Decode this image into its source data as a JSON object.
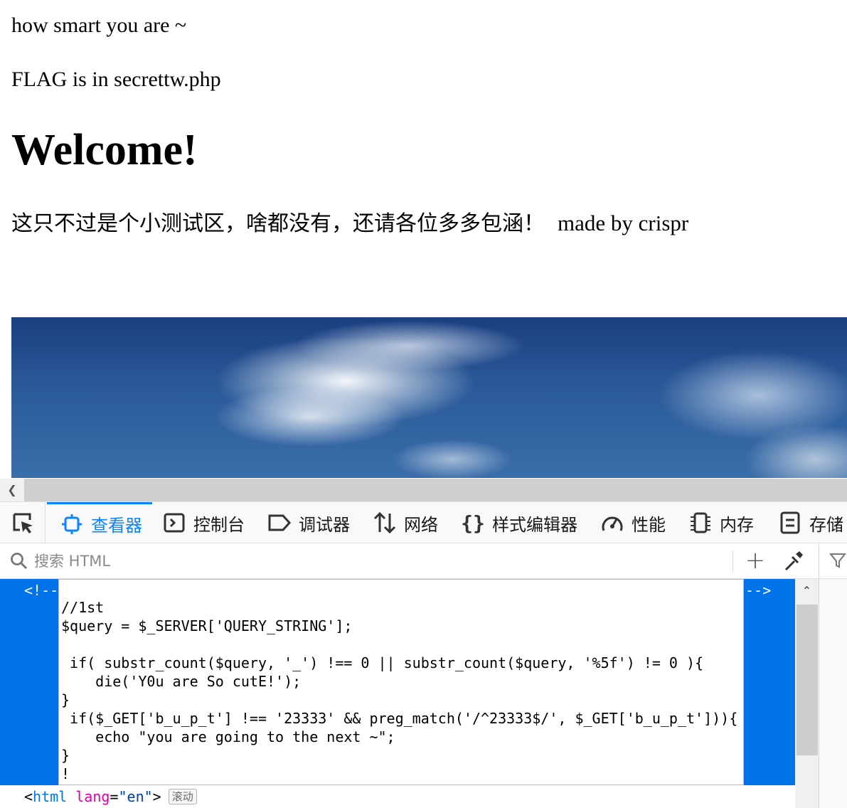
{
  "page": {
    "line1": "how smart you are ~",
    "line2": "FLAG is in secrettw.php",
    "heading": "Welcome!",
    "notice_cn": "这只不过是个小测试区，啥都没有，还请各位多多包涵！",
    "notice_by": "made by crispr"
  },
  "devtools": {
    "tabs": [
      {
        "label": "查看器",
        "icon": "inspector-icon",
        "active": true
      },
      {
        "label": "控制台",
        "icon": "console-icon"
      },
      {
        "label": "调试器",
        "icon": "debugger-icon"
      },
      {
        "label": "网络",
        "icon": "network-icon"
      },
      {
        "label": "样式编辑器",
        "icon": "style-editor-icon"
      },
      {
        "label": "性能",
        "icon": "performance-icon"
      },
      {
        "label": "内存",
        "icon": "memory-icon"
      },
      {
        "label": "存储",
        "icon": "storage-icon"
      }
    ],
    "search_placeholder": "搜索 HTML",
    "plus": "+",
    "comment_open": "<!--",
    "comment_close": "-->",
    "code": "\n//1st\n$query = $_SERVER['QUERY_STRING'];\n\n if( substr_count($query, '_') !== 0 || substr_count($query, '%5f') != 0 ){\n    die('Y0u are So cutE!');\n}\n if($_GET['b_u_p_t'] !== '23333' && preg_match('/^23333$/', $_GET['b_u_p_t'])){\n    echo \"you are going to the next ~\";\n}\n!",
    "breadcrumb": {
      "lt": "<",
      "tag": "html",
      "attr": "lang",
      "eq": "=",
      "value": "\"en\"",
      "gt": ">",
      "badge": "滚动"
    },
    "accent_color": "#0a84ff",
    "selection_color": "#0074e8"
  }
}
